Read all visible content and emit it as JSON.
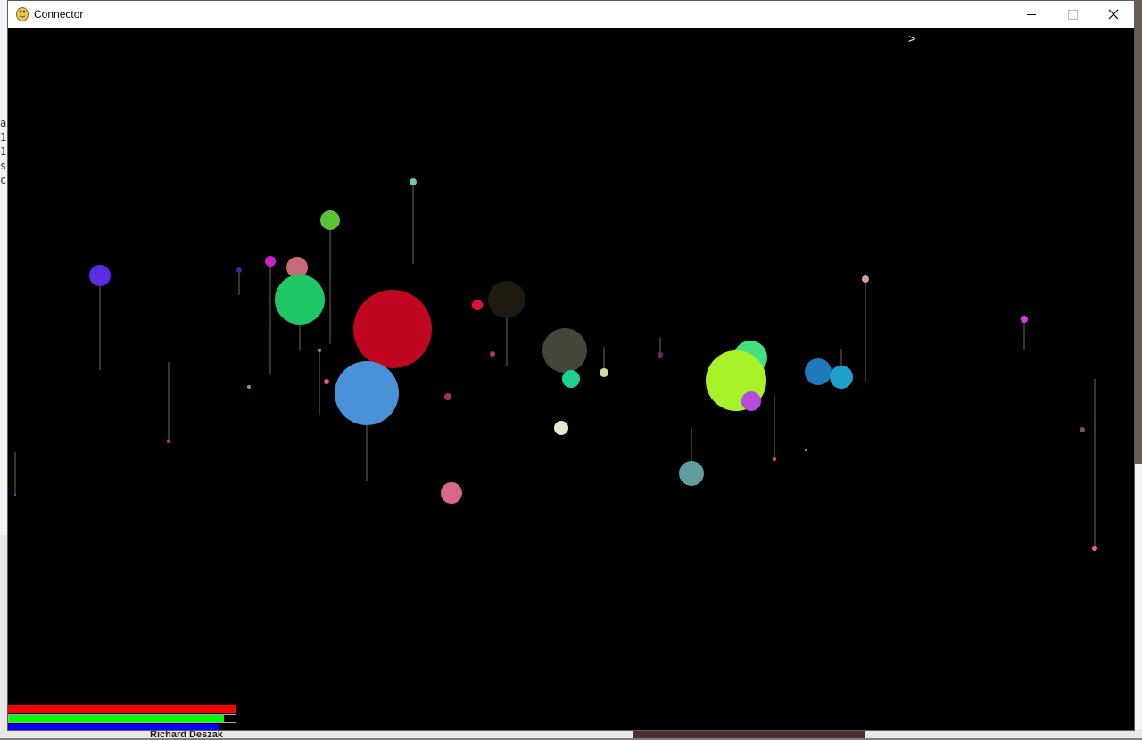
{
  "window": {
    "title": "Connector"
  },
  "canvas": {
    "prompt": ">"
  },
  "colors": {
    "titlebar": "#ffffff",
    "canvas": "#000000",
    "health": "#ff0000",
    "energy": "#00ff00",
    "mana": "#0000ff"
  },
  "status_bars": [
    {
      "name": "red",
      "color": "#ff0000",
      "fill": 1.0
    },
    {
      "name": "green",
      "color": "#00ff00",
      "fill": 0.95
    },
    {
      "name": "blue",
      "color": "#0000ff",
      "fill": 0.92
    }
  ],
  "background": {
    "left_text": [
      "a",
      "1",
      "1",
      "s",
      "c"
    ],
    "bottom_text": "Richard Deszak"
  }
}
